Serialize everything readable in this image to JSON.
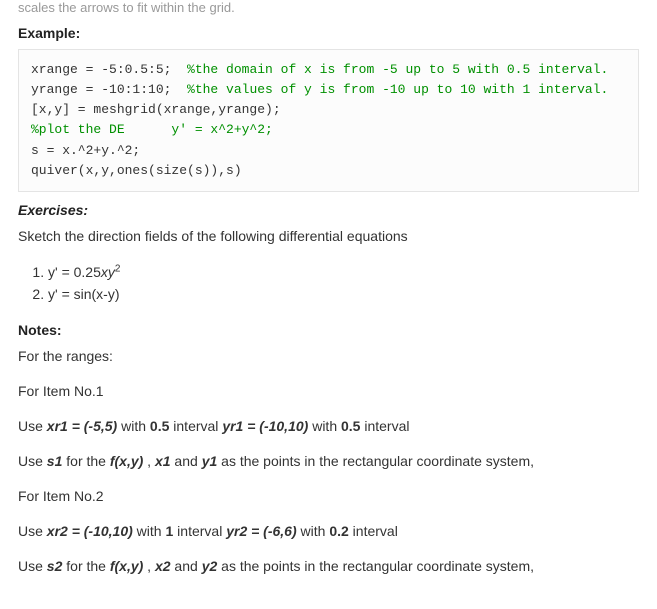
{
  "cutoff_text": "scales the arrows to fit within the grid.",
  "headings": {
    "example": "Example:",
    "exercises": "Exercises:",
    "notes": "Notes:"
  },
  "code": {
    "l1a": "xrange = -5:0.5:5;  ",
    "l1c": "%the domain of x is from -5 up to 5 with 0.5 interval.",
    "l2a": "yrange = -10:1:10;  ",
    "l2c": "%the values of y is from -10 up to 10 with 1 interval.",
    "l3": "[x,y] = meshgrid(xrange,yrange);",
    "l4c": "%plot the DE      y' = x^2+y^2;",
    "l5": "s = x.^2+y.^2;",
    "l6": "quiver(x,y,ones(size(s)),s)"
  },
  "exercise_intro": "Sketch the direction fields of the following differential equations",
  "exercise_items": {
    "e1_pre": "y' = 0.25",
    "e1_mid": "xy",
    "e1_sup": "2",
    "e2": "y' = sin(x-y)"
  },
  "notes": {
    "ranges": "For the ranges:",
    "item1": "For Item No.1",
    "r1_use": "Use ",
    "r1_xr": "xr1 = (-5,5)",
    "r1_with1": " with ",
    "r1_int1": "0.5",
    "r1_interval1": " interval   ",
    "r1_yr": "yr1 = (-10,10)",
    "r1_with2": " with ",
    "r1_int2": "0.5",
    "r1_interval2": " interval",
    "u1_use": "Use ",
    "u1_s": "s1",
    "u1_for": " for the ",
    "u1_f": "f(x,y)",
    "u1_sep": " , ",
    "u1_x": "x1",
    "u1_and": " and ",
    "u1_y": "y1",
    "u1_tail": " as the points in the rectangular coordinate system,",
    "item2": "For Item No.2",
    "r2_use": "Use ",
    "r2_xr": "xr2 = (-10,10)",
    "r2_with1": " with ",
    "r2_int1": "1",
    "r2_interval1": " interval   ",
    "r2_yr": "yr2 = (-6,6)",
    "r2_with2": " with ",
    "r2_int2": "0.2",
    "r2_interval2": " interval",
    "u2_use": "Use ",
    "u2_s": "s2",
    "u2_for": " for the ",
    "u2_f": "f(x,y)",
    "u2_sep": " , ",
    "u2_x": "x2",
    "u2_and": " and ",
    "u2_y": "y2",
    "u2_tail": " as the points in the rectangular coordinate system,"
  }
}
